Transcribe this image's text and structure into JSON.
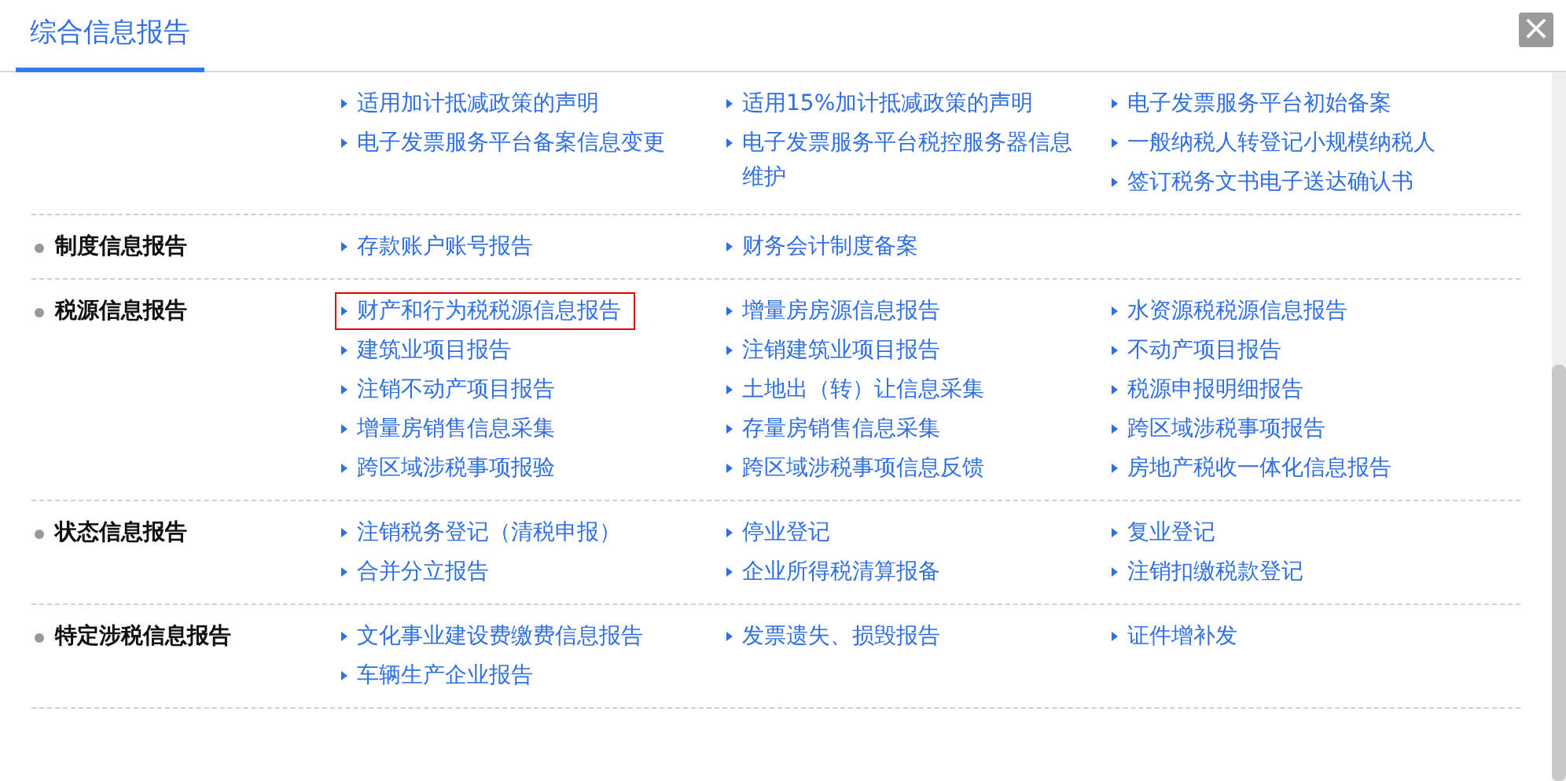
{
  "tabs": [
    {
      "label": "综合信息报告",
      "selected": true
    }
  ],
  "close": {
    "label": "×"
  },
  "groups": [
    {
      "columns": [
        [
          {
            "label": "适用加计抵减政策的声明",
            "selected": false
          },
          {
            "label": "电子发票服务平台备案信息变更",
            "selected": false
          }
        ],
        [
          {
            "label": "适用15%加计抵减政策的声明",
            "selected": false
          },
          {
            "label": "电子发票服务平台税控服务器信息维护",
            "selected": false
          }
        ],
        [
          {
            "label": "电子发票服务平台初始备案",
            "selected": false
          },
          {
            "label": "一般纳税人转登记小规模纳税人",
            "selected": false
          },
          {
            "label": "签订税务文书电子送达确认书",
            "selected": false
          }
        ]
      ]
    },
    {
      "title": "制度信息报告",
      "columns": [
        [
          {
            "label": "存款账户账号报告",
            "selected": false
          }
        ],
        [
          {
            "label": "财务会计制度备案",
            "selected": false
          }
        ],
        []
      ]
    },
    {
      "title": "税源信息报告",
      "columns": [
        [
          {
            "label": "财产和行为税税源信息报告",
            "selected": true
          },
          {
            "label": "建筑业项目报告",
            "selected": false
          },
          {
            "label": "注销不动产项目报告",
            "selected": false
          },
          {
            "label": "增量房销售信息采集",
            "selected": false
          },
          {
            "label": "跨区域涉税事项报验",
            "selected": false
          }
        ],
        [
          {
            "label": "增量房房源信息报告",
            "selected": false
          },
          {
            "label": "注销建筑业项目报告",
            "selected": false
          },
          {
            "label": "土地出（转）让信息采集",
            "selected": false
          },
          {
            "label": "存量房销售信息采集",
            "selected": false
          },
          {
            "label": "跨区域涉税事项信息反馈",
            "selected": false
          }
        ],
        [
          {
            "label": "水资源税税源信息报告",
            "selected": false
          },
          {
            "label": "不动产项目报告",
            "selected": false
          },
          {
            "label": "税源申报明细报告",
            "selected": false
          },
          {
            "label": "跨区域涉税事项报告",
            "selected": false
          },
          {
            "label": "房地产税收一体化信息报告",
            "selected": false
          }
        ]
      ]
    },
    {
      "title": "状态信息报告",
      "columns": [
        [
          {
            "label": "注销税务登记（清税申报）",
            "selected": false
          },
          {
            "label": "合并分立报告",
            "selected": false
          }
        ],
        [
          {
            "label": "停业登记",
            "selected": false
          },
          {
            "label": "企业所得税清算报备",
            "selected": false
          }
        ],
        [
          {
            "label": "复业登记",
            "selected": false
          },
          {
            "label": "注销扣缴税款登记",
            "selected": false
          }
        ]
      ]
    },
    {
      "title": "特定涉税信息报告",
      "columns": [
        [
          {
            "label": "文化事业建设费缴费信息报告",
            "selected": false
          },
          {
            "label": "车辆生产企业报告",
            "selected": false
          }
        ],
        [
          {
            "label": "发票遗失、损毁报告",
            "selected": false
          }
        ],
        [
          {
            "label": "证件增补发",
            "selected": false
          }
        ]
      ]
    }
  ]
}
